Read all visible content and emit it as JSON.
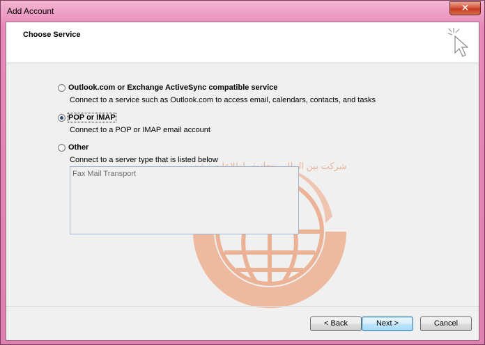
{
  "window": {
    "title": "Add Account",
    "close_glyph": "✕"
  },
  "header": {
    "title": "Choose Service",
    "icon": "cursor-sparkle-icon"
  },
  "options": [
    {
      "label": "Outlook.com or Exchange ActiveSync compatible service",
      "description": "Connect to a service such as Outlook.com to access email, calendars, contacts, and tasks",
      "checked": false
    },
    {
      "label": "POP or IMAP",
      "description": "Connect to a POP or IMAP email account",
      "checked": true
    },
    {
      "label": "Other",
      "description": "Connect to a server type that is listed below",
      "checked": false
    }
  ],
  "server_list": {
    "items": [
      "Fax Mail Transport"
    ]
  },
  "buttons": {
    "back": "< Back",
    "next": "Next >",
    "cancel": "Cancel"
  },
  "watermark": {
    "text": "شرکت بین المللی پردازش اطلاعات نوژن"
  },
  "colors": {
    "accent": "#3c7fb1",
    "watermark": "#e87a4a"
  }
}
